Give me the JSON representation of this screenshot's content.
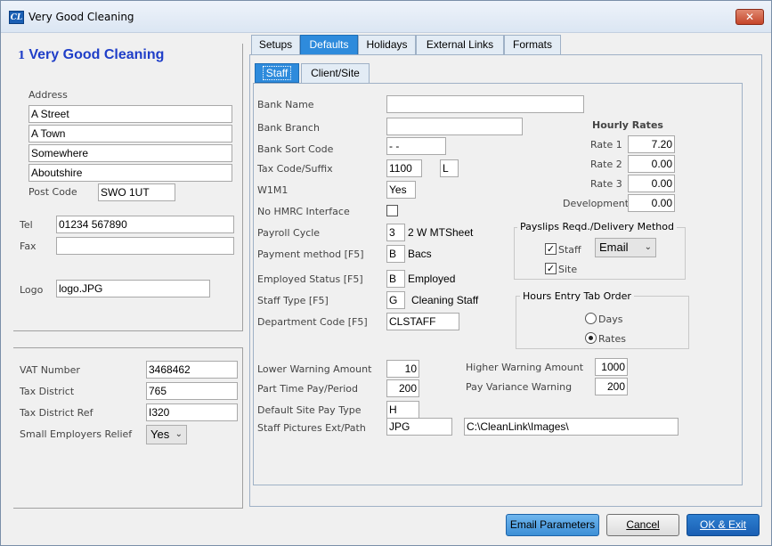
{
  "window": {
    "title": "Very Good Cleaning",
    "app_icon": "CL",
    "close_label": "✕"
  },
  "company": {
    "number": "1",
    "name": "Very Good Cleaning"
  },
  "address": {
    "label": "Address",
    "lines": [
      "A Street",
      "A Town",
      "Somewhere",
      "Aboutshire"
    ],
    "postcode_label": "Post  Code",
    "postcode": "SWO 1UT"
  },
  "contact": {
    "tel_label": "Tel",
    "tel": "01234 567890",
    "fax_label": "Fax",
    "fax": "",
    "logo_label": "Logo",
    "logo": "logo.JPG"
  },
  "tax": {
    "vat_label": "VAT Number",
    "vat": "3468462",
    "district_label": "Tax District",
    "district": "765",
    "district_ref_label": "Tax District Ref",
    "district_ref": "I320",
    "ser_label": "Small Employers Relief",
    "ser": "Yes"
  },
  "tabs": [
    "Setups",
    "Defaults",
    "Holidays",
    "External Links",
    "Formats"
  ],
  "subtabs": [
    "Staff",
    "Client/Site"
  ],
  "staff": {
    "bank_name_label": "Bank Name",
    "bank_name": "",
    "bank_branch_label": "Bank Branch",
    "bank_branch": "",
    "sort_code_label": "Bank Sort Code",
    "sort_code": " -  -",
    "tax_code_label": "Tax Code/Suffix",
    "tax_code": "1100",
    "tax_suffix": "L",
    "w1m1_label": "W1M1",
    "w1m1": "Yes",
    "no_hmrc_label": "No HMRC Interface",
    "no_hmrc": "",
    "payroll_cycle_label": "Payroll Cycle",
    "payroll_cycle": "3",
    "payroll_cycle_desc": "2 W MTSheet",
    "payment_method_label": "Payment method [F5]",
    "payment_method": "B",
    "payment_method_desc": "Bacs",
    "employed_status_label": "Employed Status [F5]",
    "employed_status": "B",
    "employed_status_desc": "Employed",
    "staff_type_label": "Staff Type [F5]",
    "staff_type": "G",
    "staff_type_desc": "Cleaning Staff",
    "dept_code_label": "Department Code [F5]",
    "dept_code": "CLSTAFF",
    "lower_warning_label": "Lower Warning Amount",
    "lower_warning": "10",
    "part_time_label": "Part Time Pay/Period",
    "part_time": "200",
    "default_site_pay_label": "Default Site Pay Type",
    "default_site_pay": "H",
    "pictures_label": "Staff Pictures Ext/Path",
    "pictures_ext": "JPG",
    "pictures_path": "C:\\CleanLink\\Images\\",
    "higher_warning_label": "Higher Warning Amount",
    "higher_warning": "1000",
    "pay_variance_label": "Pay Variance Warning",
    "pay_variance": "200"
  },
  "hourly_rates": {
    "title": "Hourly Rates",
    "rate1_label": "Rate 1",
    "rate1": "7.20",
    "rate2_label": "Rate 2",
    "rate2": "0.00",
    "rate3_label": "Rate 3",
    "rate3": "0.00",
    "dev_label": "Development",
    "dev": "0.00"
  },
  "payslips": {
    "title": "Payslips Reqd./Delivery Method",
    "staff_label": "Staff",
    "staff_checked": "✓",
    "site_label": "Site",
    "site_checked": "✓",
    "method": "Email"
  },
  "hours_entry": {
    "title": "Hours Entry Tab Order",
    "days_label": "Days",
    "rates_label": "Rates"
  },
  "buttons": {
    "email": "Email Parameters",
    "cancel": "Cancel",
    "ok": "OK & Exit"
  },
  "colors": {
    "accent": "#2e8bdc",
    "company_name": "#1f3ec8",
    "ok_button": "#1a5fb3"
  }
}
